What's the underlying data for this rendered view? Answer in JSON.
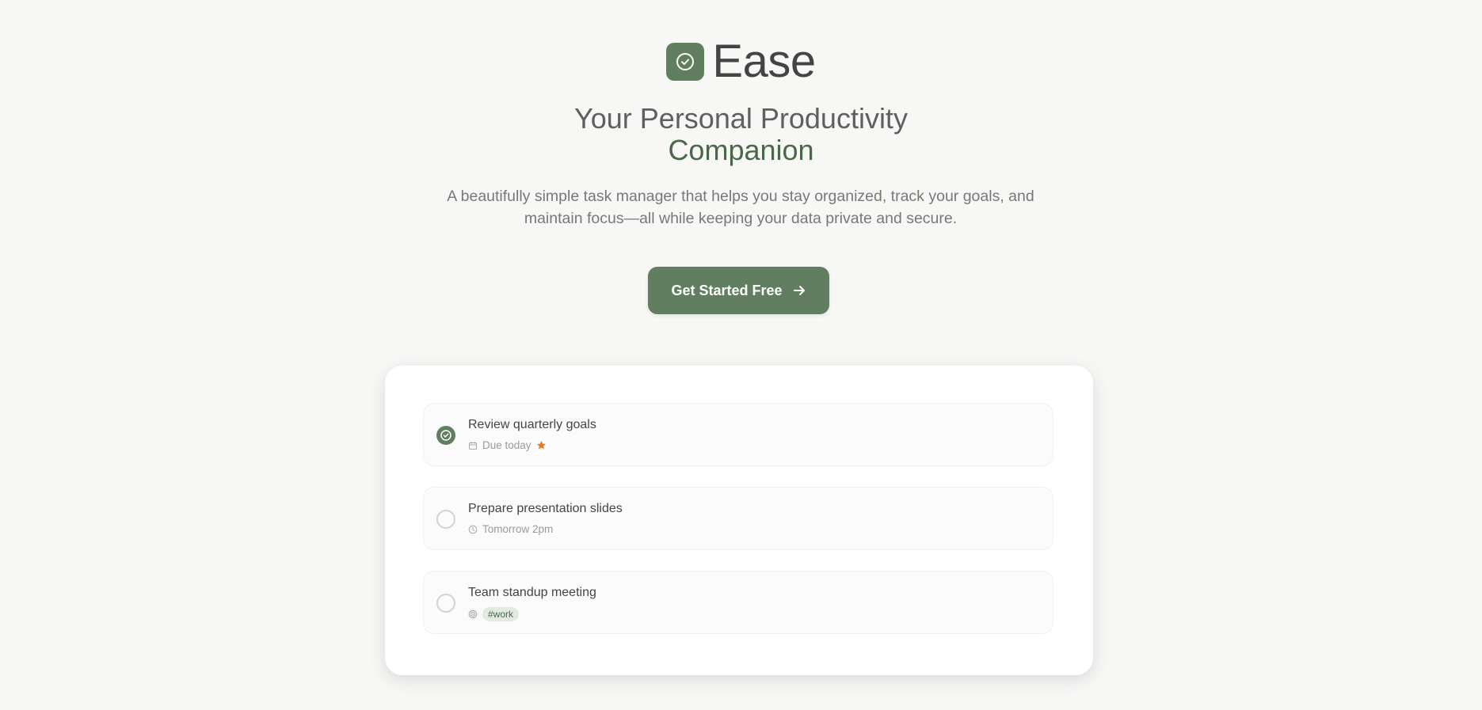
{
  "brand": {
    "name": "Ease",
    "logo_icon": "check-circle-icon"
  },
  "headline": {
    "line1": "Your Personal Productivity",
    "line2": "Companion"
  },
  "subtitle": {
    "line1": "A beautifully simple task manager that helps you stay organized, track your goals, and",
    "line2": "maintain focus—all while keeping your data private and secure."
  },
  "cta": {
    "label": "Get Started Free",
    "icon": "arrow-right-icon"
  },
  "tasks": [
    {
      "title": "Review quarterly goals",
      "completed": true,
      "meta_icon": "calendar-icon",
      "meta_text": "Due today",
      "flag_icon": "star-icon"
    },
    {
      "title": "Prepare presentation slides",
      "completed": false,
      "meta_icon": "clock-icon",
      "meta_text": "Tomorrow 2pm"
    },
    {
      "title": "Team standup meeting",
      "completed": false,
      "meta_icon": "target-icon",
      "tag": "#work"
    }
  ],
  "colors": {
    "accent": "#617e60",
    "accent_text": "#4a6849",
    "star": "#e8792b",
    "background": "#f7f7f6",
    "tag_bg": "#e3ebe1"
  }
}
